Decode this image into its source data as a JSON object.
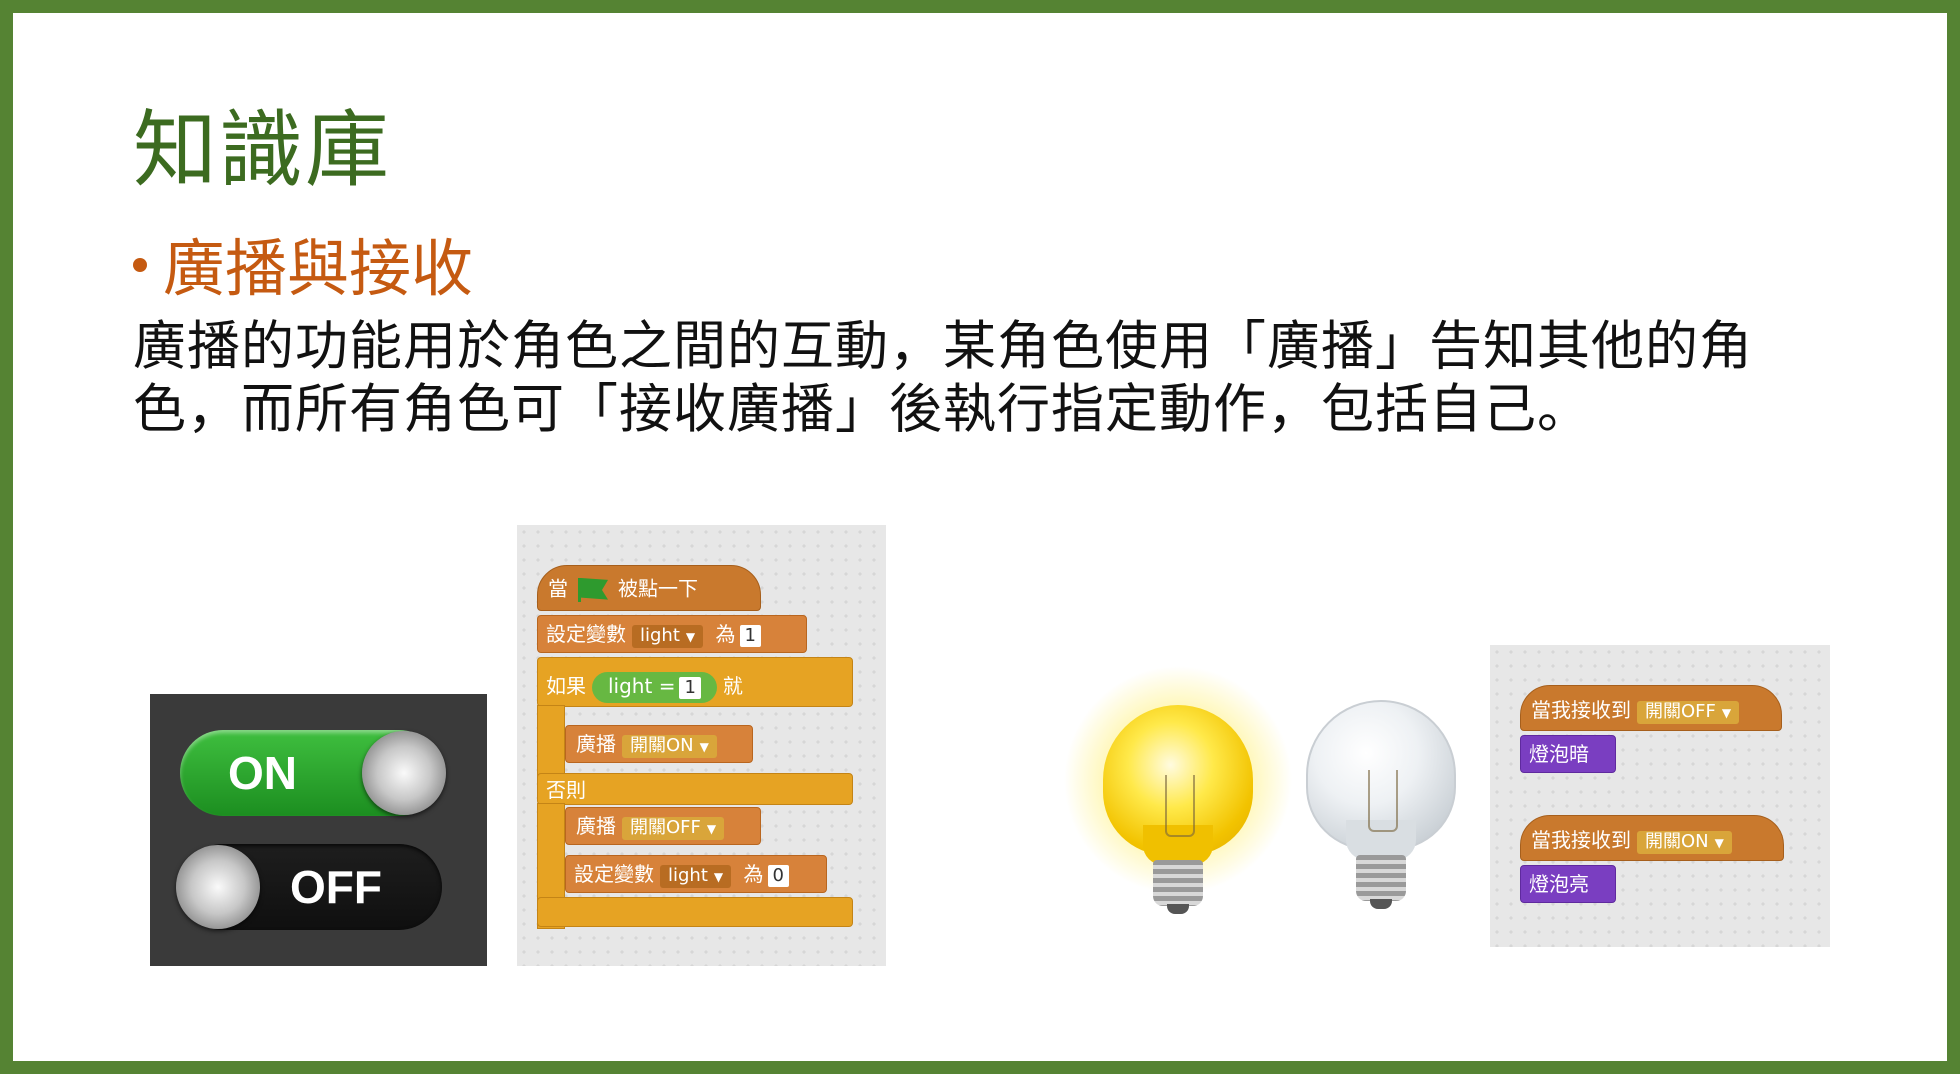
{
  "slide": {
    "title": "知識庫",
    "bullet": "廣播與接收",
    "body": "廣播的功能用於角色之間的互動，某角色使用「廣播」告知其他的角色，而所有角色可「接收廣播」後執行指定動作，包括自己。"
  },
  "switch_image": {
    "on_label": "ON",
    "off_label": "OFF"
  },
  "scratch_main": {
    "when": "當",
    "clicked": "被點一下",
    "set_var": "設定變數",
    "var_name": "light",
    "to": "為",
    "val1": "1",
    "if": "如果",
    "equals": "=",
    "then": "就",
    "broadcast": "廣播",
    "msg_on": "開關ON",
    "else": "否則",
    "msg_off": "開關OFF",
    "val0": "0"
  },
  "scratch_right": {
    "receive": "當我接收到",
    "msg_off": "開關OFF",
    "dark": "燈泡暗",
    "msg_on": "開關ON",
    "bright": "燈泡亮"
  },
  "icons": [
    "green-flag-icon",
    "lit-bulb-icon",
    "unlit-bulb-icon",
    "toggle-knob-icon"
  ],
  "colors": {
    "border": "#558333",
    "title": "#3c6b20",
    "accent": "#c55a11"
  }
}
